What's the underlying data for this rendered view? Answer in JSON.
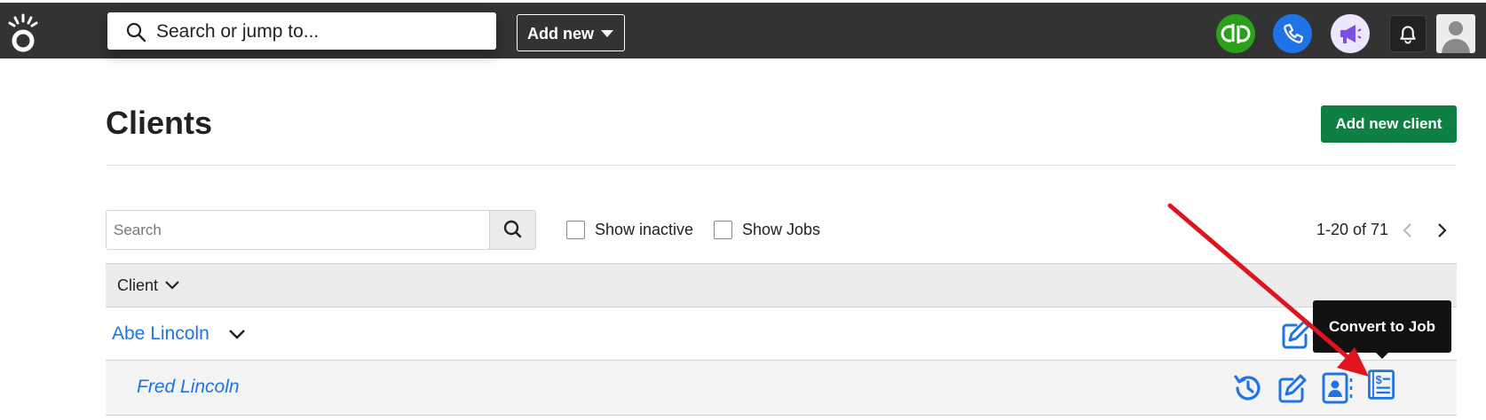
{
  "topbar": {
    "search_placeholder": "Search or jump to...",
    "add_new_label": "Add new",
    "icons": [
      "logo-icon",
      "quickbooks-icon",
      "phone-icon",
      "megaphone-icon",
      "bell-icon",
      "user-avatar-icon"
    ],
    "colors": {
      "bar": "#333333",
      "quickbooks": "#2ca01c",
      "phone": "#1e73e8",
      "megaphone_bg": "#ece6ff",
      "megaphone": "#7b4fe0"
    }
  },
  "page": {
    "title": "Clients",
    "add_button_label": "Add new client",
    "add_button_color": "#0f8043"
  },
  "filters": {
    "search_placeholder": "Search",
    "show_inactive_label": "Show inactive",
    "show_jobs_label": "Show Jobs",
    "show_inactive_checked": false,
    "show_jobs_checked": false,
    "pagination": "1-20 of 71"
  },
  "table": {
    "column_header": "Client",
    "rows": [
      {
        "name": "Abe Lincoln",
        "type": "client",
        "actions": [
          "edit-icon"
        ]
      },
      {
        "name": "Fred Lincoln",
        "type": "job",
        "actions": [
          "history-icon",
          "edit-icon",
          "contact-card-icon",
          "convert-to-job-icon"
        ]
      }
    ],
    "link_color": "#1e73e8"
  },
  "tooltip": {
    "text": "Convert to Job"
  },
  "annotation": {
    "arrow_color": "#e0141e"
  }
}
